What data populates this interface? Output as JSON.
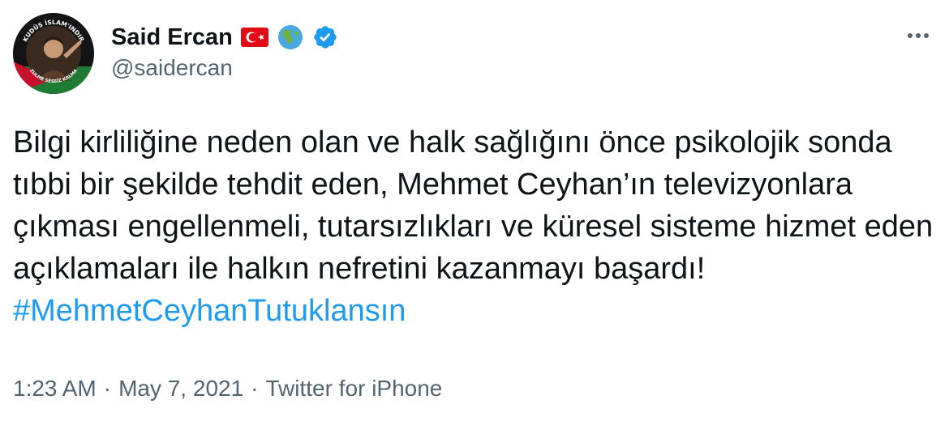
{
  "author": {
    "display_name": "Said Ercan",
    "username": "@saidercan",
    "avatar_badge_top": "KUDÜS İSLAM'INDIR",
    "avatar_badge_bottom": "ZULME SESSİZ KALMA",
    "flag_icon": "turkey-flag-icon",
    "globe_icon": "globe-icon",
    "verified_icon": "verified-badge-icon"
  },
  "tweet": {
    "text": "Bilgi kirliliğine neden olan ve halk sağlığını önce psikolojik sonda tıbbi bir şekilde tehdit eden, Mehmet Ceyhan’ın televizyonlara çıkması engellenmeli, tutarsızlıkları ve küresel sisteme hizmet eden açıklamaları ile halkın nefretini kazanmayı başardı! ",
    "hashtag": "#MehmetCeyhanTutuklansın"
  },
  "meta": {
    "time": "1:23 AM",
    "separator": "·",
    "date": "May 7, 2021",
    "source": "Twitter for iPhone"
  },
  "colors": {
    "hashtag": "#1d9bf0",
    "secondary_text": "#536471",
    "verified": "#1d9bf0",
    "flag": "#e30a17"
  }
}
